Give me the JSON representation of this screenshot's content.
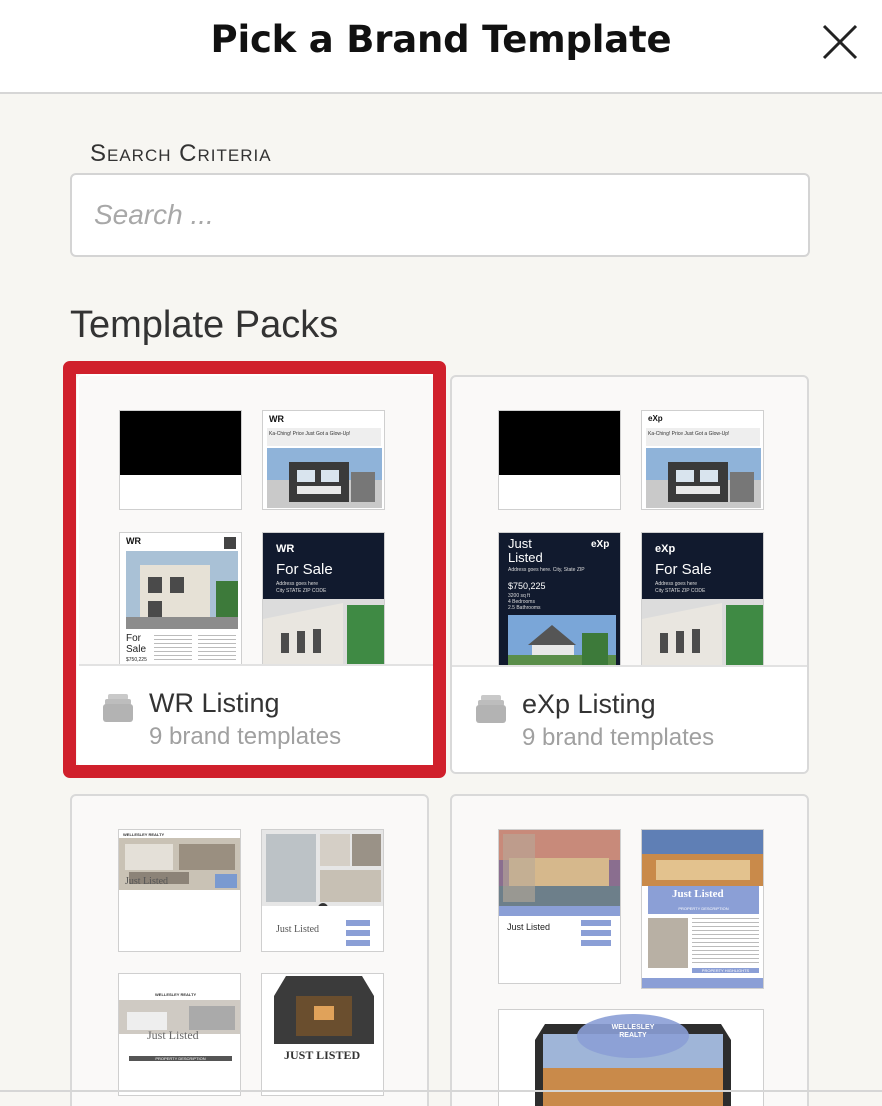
{
  "header": {
    "title": "Pick a Brand Template",
    "close_icon": "close-icon"
  },
  "search": {
    "label": "Search Criteria",
    "placeholder": "Search ...",
    "value": ""
  },
  "section": {
    "title": "Template Packs"
  },
  "packs": [
    {
      "name": "WR Listing",
      "count_text": "9 brand templates",
      "selected": true,
      "brand_mark": "WR",
      "thumbs": {
        "web_headline": "Ka-Ching! Price Just Got a Glow-Up!",
        "flyer_title": "For Sale",
        "flyer_price": "$750,225",
        "postcard_title": "For Sale",
        "postcard_address": "Address goes here",
        "postcard_city": "City STATE ZIP CODE"
      }
    },
    {
      "name": "eXp Listing",
      "count_text": "9 brand templates",
      "selected": false,
      "brand_mark": "eXp",
      "thumbs": {
        "web_headline": "Ka-Ching! Price Just Got a Glow-Up!",
        "listed_title": "Just Listed",
        "listed_address": "Address goes here. City, State ZIP",
        "listed_price": "$750,225",
        "listed_sqft": "3200 sq ft",
        "listed_beds": "4 Bedrooms",
        "listed_baths": "2.5 Bathrooms",
        "postcard_title": "For Sale",
        "postcard_address": "Address goes here",
        "postcard_city": "City STATE ZIP CODE"
      }
    },
    {
      "name": "",
      "count_text": "",
      "brand_mark": "WELLESLEY REALTY",
      "thumbs": {
        "a_title": "Just Listed",
        "b_title": "Just Listed",
        "c_title": "Just Listed",
        "c_sub": "PROPERTY DESCRIPTION",
        "d_title": "JUST LISTED"
      }
    },
    {
      "name": "",
      "count_text": "",
      "brand_mark": "WELLESLEY REALTY",
      "thumbs": {
        "a_title": "Just Listed",
        "b_title": "Just Listed",
        "b_sub1": "PROPERTY DESCRIPTION",
        "b_sub2": "PROPERTY HIGHLIGHTS"
      }
    }
  ],
  "colors": {
    "accent_selected": "#d0202c",
    "navy": "#111a2e",
    "periwinkle": "#8b9fd6"
  }
}
